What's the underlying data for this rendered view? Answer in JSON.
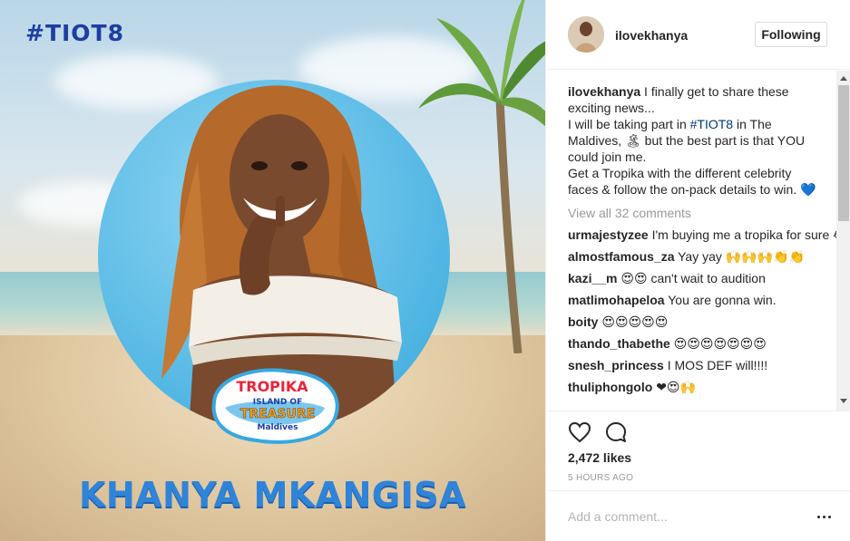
{
  "image": {
    "tag": "#TIOT8",
    "name": "KHANYA MKANGISA",
    "logo": {
      "line1": "TROPIKA",
      "line2": "ISLAND OF",
      "line3": "TREASURE",
      "line4": "Maldives"
    }
  },
  "header": {
    "username": "ilovekhanya",
    "follow_label": "Following"
  },
  "caption": {
    "username": "ilovekhanya",
    "text_before": "I finally get to share these exciting news...",
    "line2_before": "I will be taking part in ",
    "hashtag": "#TIOT8",
    "line2_after": " in The Maldives, 🏝 but the best part is that YOU could join me.",
    "line3": "Get a Tropika with the different celebrity faces & follow the on-pack details to win. 💙"
  },
  "view_all": "View all 32 comments",
  "comments": [
    {
      "user": "urmajestyzee",
      "text": "I'm buying me a tropika for sure 😂😂😂😂"
    },
    {
      "user": "almostfamous_za",
      "text": "Yay yay 🙌🙌🙌👏👏"
    },
    {
      "user": "kazi__m",
      "text": "😍😍 can't wait to audition"
    },
    {
      "user": "matlimohapeloa",
      "text": "You are gonna win."
    },
    {
      "user": "boity",
      "text": "😍😍😍😍😍"
    },
    {
      "user": "thando_thabethe",
      "text": "😍😍😍😍😍😍😍"
    },
    {
      "user": "snesh_princess",
      "text": "I MOS DEF will!!!!"
    },
    {
      "user": "thuliphongolo",
      "text": "❤😍🙌"
    }
  ],
  "likes": "2,472 likes",
  "timestamp": "5 HOURS AGO",
  "add_comment_placeholder": "Add a comment...",
  "icons": {
    "like": "heart-icon",
    "comment": "comment-icon",
    "more": "more-options-icon"
  },
  "colors": {
    "tag": "#1e3ea0",
    "name": "#2f84d8",
    "hashtag": "#003569",
    "muted": "#999999"
  }
}
